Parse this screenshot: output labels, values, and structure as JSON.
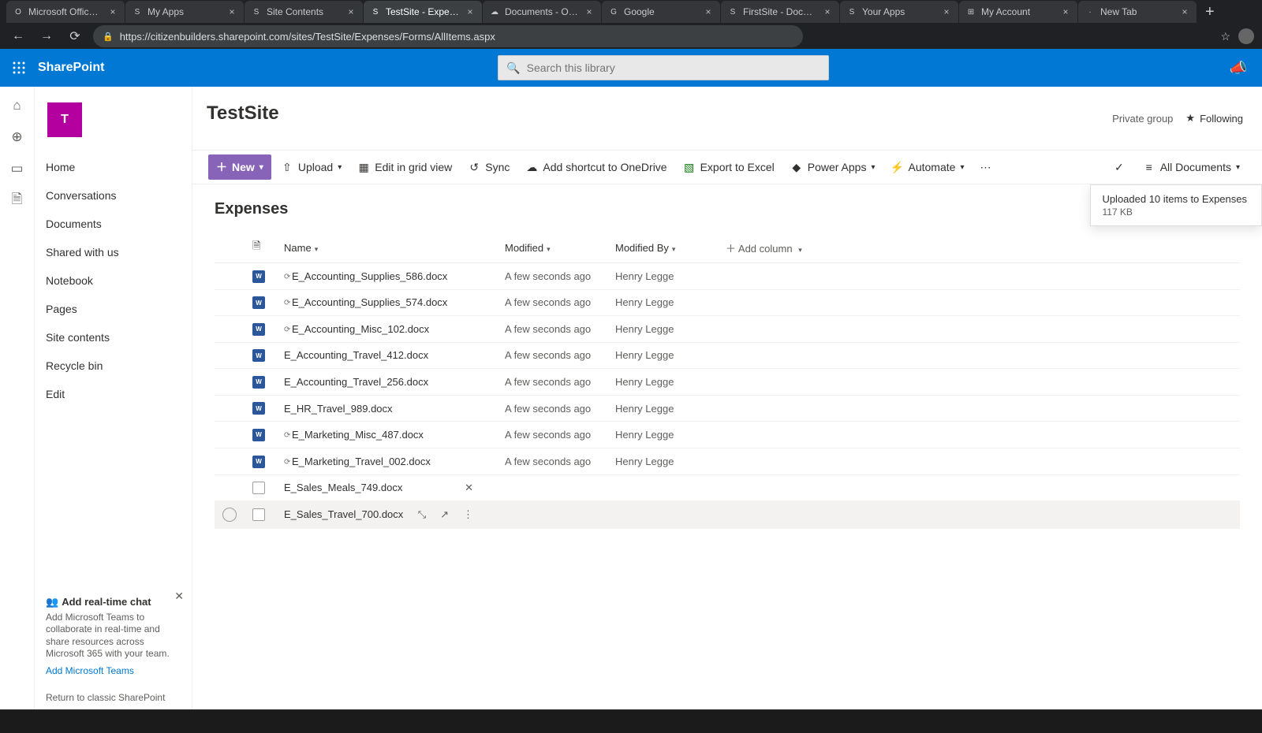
{
  "browser": {
    "tabs": [
      {
        "title": "Microsoft Office H…",
        "favicon": "O",
        "active": false
      },
      {
        "title": "My Apps",
        "favicon": "S",
        "active": false
      },
      {
        "title": "Site Contents",
        "favicon": "S",
        "active": false
      },
      {
        "title": "TestSite - Expenses",
        "favicon": "S",
        "active": true
      },
      {
        "title": "Documents - OneD…",
        "favicon": "☁",
        "active": false
      },
      {
        "title": "Google",
        "favicon": "G",
        "active": false
      },
      {
        "title": "FirstSite - Docume…",
        "favicon": "S",
        "active": false
      },
      {
        "title": "Your Apps",
        "favicon": "S",
        "active": false
      },
      {
        "title": "My Account",
        "favicon": "⊞",
        "active": false
      },
      {
        "title": "New Tab",
        "favicon": "·",
        "active": false
      }
    ],
    "url": "https://citizenbuilders.sharepoint.com/sites/TestSite/Expenses/Forms/AllItems.aspx"
  },
  "suite": {
    "product": "SharePoint",
    "search_placeholder": "Search this library"
  },
  "site": {
    "logo_letter": "T",
    "title": "TestSite",
    "privacy": "Private group",
    "following": "Following"
  },
  "leftNav": {
    "items": [
      "Home",
      "Conversations",
      "Documents",
      "Shared with us",
      "Notebook",
      "Pages",
      "Site contents",
      "Recycle bin",
      "Edit"
    ]
  },
  "teamsPromo": {
    "title": "Add real-time chat",
    "body": "Add Microsoft Teams to collaborate in real-time and share resources across Microsoft 365 with your team.",
    "link": "Add Microsoft Teams"
  },
  "classicLink": "Return to classic SharePoint",
  "commandBar": {
    "new": "New",
    "upload": "Upload",
    "editGrid": "Edit in grid view",
    "sync": "Sync",
    "shortcut": "Add shortcut to OneDrive",
    "export": "Export to Excel",
    "powerApps": "Power Apps",
    "automate": "Automate",
    "view": "All Documents"
  },
  "library": {
    "title": "Expenses",
    "toast": {
      "msg": "Uploaded 10 items to Expenses",
      "size": "117 KB"
    },
    "columns": {
      "name": "Name",
      "modified": "Modified",
      "modifiedBy": "Modified By",
      "add": "Add column"
    },
    "rows": [
      {
        "icon": "word",
        "loading": true,
        "name": "E_Accounting_Supplies_586.docx",
        "modified": "A few seconds ago",
        "by": "Henry Legge",
        "hover": false
      },
      {
        "icon": "word",
        "loading": true,
        "name": "E_Accounting_Supplies_574.docx",
        "modified": "A few seconds ago",
        "by": "Henry Legge",
        "hover": false
      },
      {
        "icon": "word",
        "loading": true,
        "name": "E_Accounting_Misc_102.docx",
        "modified": "A few seconds ago",
        "by": "Henry Legge",
        "hover": false
      },
      {
        "icon": "word",
        "loading": false,
        "name": "E_Accounting_Travel_412.docx",
        "modified": "A few seconds ago",
        "by": "Henry Legge",
        "hover": false
      },
      {
        "icon": "word",
        "loading": false,
        "name": "E_Accounting_Travel_256.docx",
        "modified": "A few seconds ago",
        "by": "Henry Legge",
        "hover": false
      },
      {
        "icon": "word",
        "loading": false,
        "name": "E_HR_Travel_989.docx",
        "modified": "A few seconds ago",
        "by": "Henry Legge",
        "hover": false
      },
      {
        "icon": "word",
        "loading": true,
        "name": "E_Marketing_Misc_487.docx",
        "modified": "A few seconds ago",
        "by": "Henry Legge",
        "hover": false
      },
      {
        "icon": "word",
        "loading": true,
        "name": "E_Marketing_Travel_002.docx",
        "modified": "A few seconds ago",
        "by": "Henry Legge",
        "hover": false
      },
      {
        "icon": "plain",
        "loading": false,
        "name": "E_Sales_Meals_749.docx",
        "modified": "",
        "by": "",
        "hover": false,
        "actions": [
          "✕"
        ]
      },
      {
        "icon": "plain",
        "loading": false,
        "name": "E_Sales_Travel_700.docx",
        "modified": "",
        "by": "",
        "hover": true,
        "actions": [
          "⤡",
          "↗",
          "⋮"
        ]
      }
    ]
  }
}
